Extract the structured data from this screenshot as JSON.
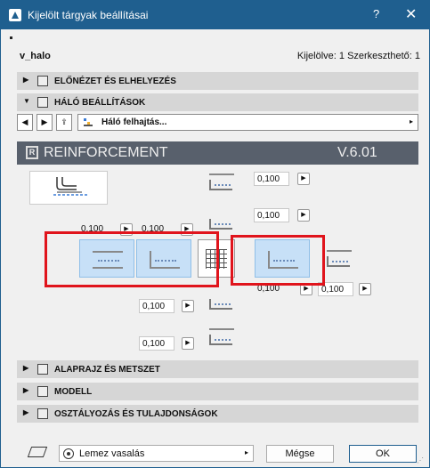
{
  "window": {
    "title": "Kijelölt tárgyak beállításai",
    "help": "?",
    "close": "✕"
  },
  "header": {
    "object_name": "v_halo",
    "selection_info": "Kijelölve: 1 Szerkeszthető: 1"
  },
  "sections": {
    "preview": "ELŐNÉZET ÉS ELHELYEZÉS",
    "mesh": "HÁLÓ BEÁLLÍTÁSOK",
    "floorplan": "ALAPRAJZ ÉS METSZET",
    "model": "MODELL",
    "classification": "OSZTÁLYOZÁS ÉS TULAJDONSÁGOK"
  },
  "toolbar": {
    "prev": "◀",
    "next": "▶",
    "dropdown_label": "Háló felhajtás...",
    "caret": "▸"
  },
  "banner": {
    "logo": "R",
    "name": "REINFORCEMENT",
    "version": "V.6.01"
  },
  "values": {
    "top1": "0,100",
    "top2": "0,100",
    "left1": "0,100",
    "left2": "0,100",
    "right1": "0,100",
    "right2": "0,100",
    "bottom1": "0,100",
    "bottom2": "0,100"
  },
  "arrow": "▶",
  "bottom": {
    "layer_dropdown": "Lemez vasalás",
    "cancel": "Mégse",
    "ok": "OK"
  },
  "colors": {
    "titlebar": "#1f5f8f",
    "highlight_box": "#e0141c",
    "tile_fill": "#c7e0f7"
  }
}
